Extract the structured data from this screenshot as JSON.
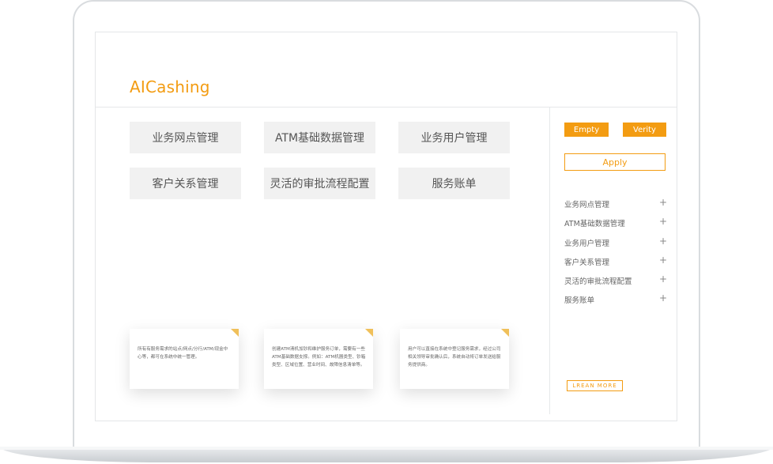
{
  "brand": {
    "logo": "AICashing",
    "accent": "#f39c12"
  },
  "tiles": [
    {
      "label": "业务网点管理"
    },
    {
      "label": "ATM基础数据管理"
    },
    {
      "label": "业务用户管理"
    },
    {
      "label": "客户关系管理"
    },
    {
      "label": "灵活的审批流程配置"
    },
    {
      "label": "服务账单"
    }
  ],
  "cards": [
    {
      "text": "所有有服务需求的站点/网点/分行/ATM/现金中心等，都可在系统中统一管理。"
    },
    {
      "text": "创建ATM清机加钞和维护服务订单，需要有一些ATM基础数据支撑。例如：ATM机器类型、钞箱类型、区域位置、营业时间、故障信息清单等。"
    },
    {
      "text": "用户可以直接在系统中登记服务需求，经过公司相关领导审批确认后，系统自动将订单发送给服务提供商。"
    }
  ],
  "sidebar": {
    "empty_label": "Empty",
    "verify_label": "Verity",
    "apply_label": "Apply",
    "more_label": "LREAN MORE",
    "menu": [
      {
        "label": "业务网点管理",
        "icon": "plus-icon"
      },
      {
        "label": "ATM基础数据管理",
        "icon": "plus-icon"
      },
      {
        "label": "业务用户管理",
        "icon": "plus-icon"
      },
      {
        "label": "客户关系管理",
        "icon": "plus-icon"
      },
      {
        "label": "灵活的审批流程配置",
        "icon": "plus-icon"
      },
      {
        "label": "服务账单",
        "icon": "plus-icon"
      }
    ]
  }
}
